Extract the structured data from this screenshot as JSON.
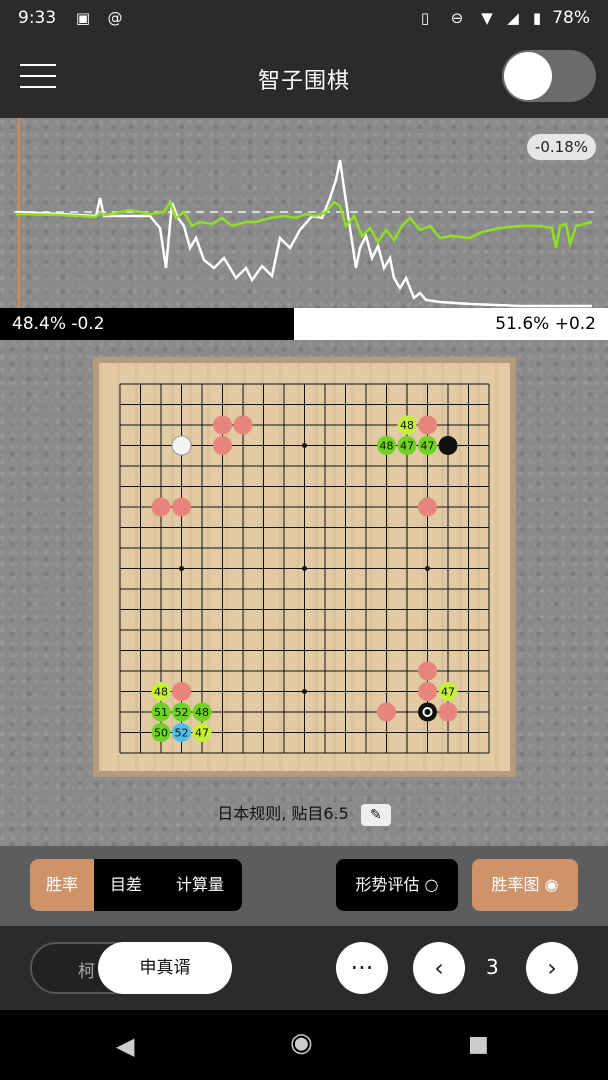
{
  "status_bar": {
    "time": "9:33",
    "battery": "78%",
    "icons": [
      "image-icon",
      "at-icon",
      "vibrate-icon",
      "dnd-icon",
      "wifi-icon",
      "signal-icon",
      "battery-icon"
    ]
  },
  "app_bar": {
    "title": "智子围棋",
    "menu_icon": "hamburger-icon",
    "toggle_on": false
  },
  "graph": {
    "badge": "-0.18%"
  },
  "win_rate_bar": {
    "black_text": "48.4% -0.2",
    "white_text": "51.6% +0.2",
    "black_fraction": 0.484
  },
  "board": {
    "size": 19,
    "stones": [
      {
        "col": 3,
        "row": 3,
        "color": "white"
      },
      {
        "col": 16,
        "row": 3,
        "color": "black"
      },
      {
        "col": 15,
        "row": 16,
        "color": "black",
        "last_move": true
      }
    ],
    "candidates_red": [
      [
        5,
        2
      ],
      [
        6,
        2
      ],
      [
        5,
        3
      ],
      [
        2,
        6
      ],
      [
        3,
        6
      ],
      [
        15,
        2
      ],
      [
        15,
        6
      ],
      [
        15,
        14
      ],
      [
        15,
        15
      ],
      [
        3,
        15
      ],
      [
        13,
        16
      ],
      [
        16,
        16
      ]
    ],
    "candidates_labeled": [
      {
        "col": 14,
        "row": 2,
        "label": "48",
        "color": "yellowgreen"
      },
      {
        "col": 13,
        "row": 3,
        "label": "48",
        "color": "green"
      },
      {
        "col": 14,
        "row": 3,
        "label": "47",
        "color": "green"
      },
      {
        "col": 15,
        "row": 3,
        "label": "47",
        "color": "green"
      },
      {
        "col": 2,
        "row": 15,
        "label": "48",
        "color": "yellowgreen"
      },
      {
        "col": 2,
        "row": 16,
        "label": "51",
        "color": "green"
      },
      {
        "col": 3,
        "row": 16,
        "label": "52",
        "color": "green"
      },
      {
        "col": 4,
        "row": 16,
        "label": "48",
        "color": "green"
      },
      {
        "col": 2,
        "row": 17,
        "label": "50",
        "color": "green"
      },
      {
        "col": 3,
        "row": 17,
        "label": "52",
        "color": "blue"
      },
      {
        "col": 4,
        "row": 17,
        "label": "47",
        "color": "yellowgreen"
      },
      {
        "col": 16,
        "row": 15,
        "label": "47",
        "color": "yellowgreen"
      },
      {
        "col": 15,
        "row": 16,
        "label": "47",
        "color": "yellowgreen"
      }
    ],
    "rule_text": "日本规则, 贴目6.5",
    "edit_icon": "pencil-icon"
  },
  "controls": {
    "seg_winrate": "胜率",
    "seg_score": "目差",
    "seg_visits": "计算量",
    "eval_button": "形势评估 ○",
    "graph_button": "胜率图 ◉"
  },
  "bottom": {
    "tab_left": "柯",
    "tab_active": "申真谞",
    "more_button": "···",
    "prev_icon": "chevron-left-icon",
    "page_number": "3",
    "next_icon": "chevron-right-icon"
  },
  "colors": {
    "accent": "#cf936a",
    "graph_green": "#8fe021",
    "candidate_red": "#e8857a",
    "candidate_green": "#6fd322",
    "candidate_yellowgreen": "#c6f03a",
    "candidate_blue": "#4fc0e8"
  }
}
